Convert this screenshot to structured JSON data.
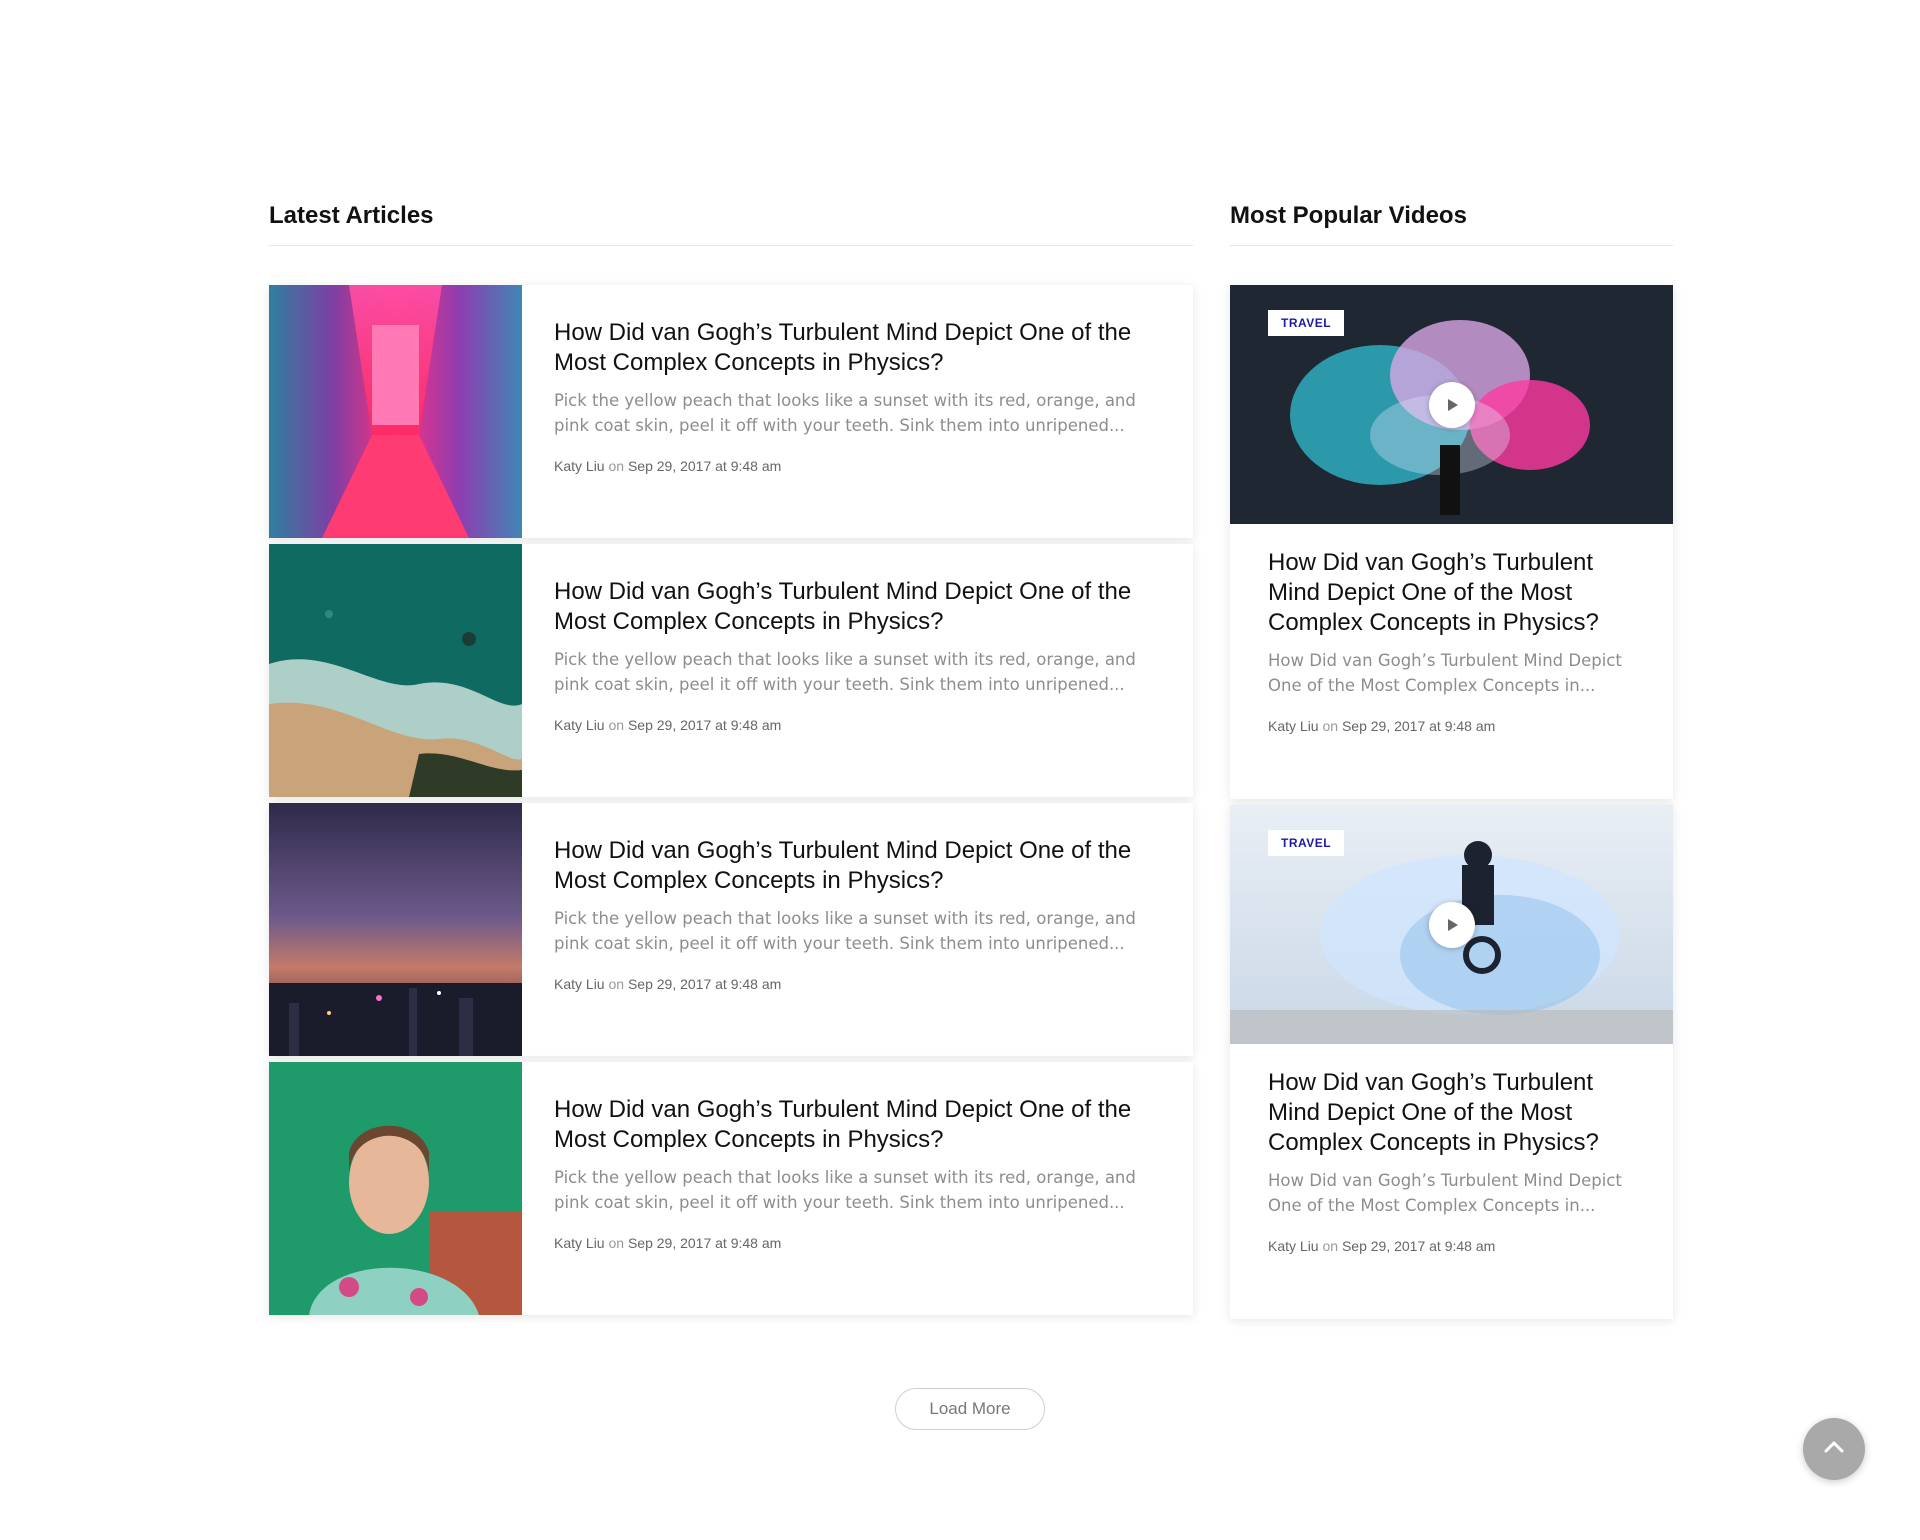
{
  "latest": {
    "heading": "Latest Articles",
    "articles": [
      {
        "title": "How Did van Gogh’s Turbulent Mind Depict One of the Most Complex Concepts in Physics?",
        "excerpt": "Pick the yellow peach that looks like a sunset with its red, orange, and pink coat skin, peel it off with your teeth. Sink them into unripened...",
        "author": "Katy Liu",
        "on": "on",
        "date": "Sep 29, 2017 at 9:48 am",
        "image": "neon-corridor-photo"
      },
      {
        "title": "How Did van Gogh’s Turbulent Mind Depict One of the Most Complex Concepts in Physics?",
        "excerpt": "Pick the yellow peach that looks like a sunset with its red, orange, and pink coat skin, peel it off with your teeth. Sink them into unripened...",
        "author": "Katy Liu",
        "on": "on",
        "date": "Sep 29, 2017 at 9:48 am",
        "image": "aerial-coast-photo"
      },
      {
        "title": "How Did van Gogh’s Turbulent Mind Depict One of the Most Complex Concepts in Physics?",
        "excerpt": "Pick the yellow peach that looks like a sunset with its red, orange, and pink coat skin, peel it off with your teeth. Sink them into unripened...",
        "author": "Katy Liu",
        "on": "on",
        "date": "Sep 29, 2017 at 9:48 am",
        "image": "night-city-photo"
      },
      {
        "title": "How Did van Gogh’s Turbulent Mind Depict One of the Most Complex Concepts in Physics?",
        "excerpt": "Pick the yellow peach that looks like a sunset with its red, orange, and pink coat skin, peel it off with your teeth. Sink them into unripened...",
        "author": "Katy Liu",
        "on": "on",
        "date": "Sep 29, 2017 at 9:48 am",
        "image": "woman-portrait-photo"
      }
    ]
  },
  "popular": {
    "heading": "Most Popular Videos",
    "videos": [
      {
        "badge": "TRAVEL",
        "title": "How Did van Gogh’s Turbulent Mind Depict One of the Most Complex Concepts in Physics?",
        "excerpt": "How Did van Gogh’s Turbulent Mind Depict One of the Most Complex Concepts in...",
        "author": "Katy Liu",
        "on": "on",
        "date": "Sep 29, 2017 at 9:48 am",
        "image": "color-smoke-photo"
      },
      {
        "badge": "TRAVEL",
        "title": "How Did van Gogh’s Turbulent Mind Depict One of the Most Complex Concepts in Physics?",
        "excerpt": "How Did van Gogh’s Turbulent Mind Depict One of the Most Complex Concepts in...",
        "author": "Katy Liu",
        "on": "on",
        "date": "Sep 29, 2017 at 9:48 am",
        "image": "bmx-jump-photo"
      }
    ]
  },
  "load_more_label": "Load More",
  "icons": {
    "play": "play-icon",
    "back_to_top": "chevron-up-icon"
  },
  "colors": {
    "badge_text": "#1d1aa7",
    "excerpt": "#8d8d8d",
    "back_to_top_bg": "#a9a9a9"
  }
}
